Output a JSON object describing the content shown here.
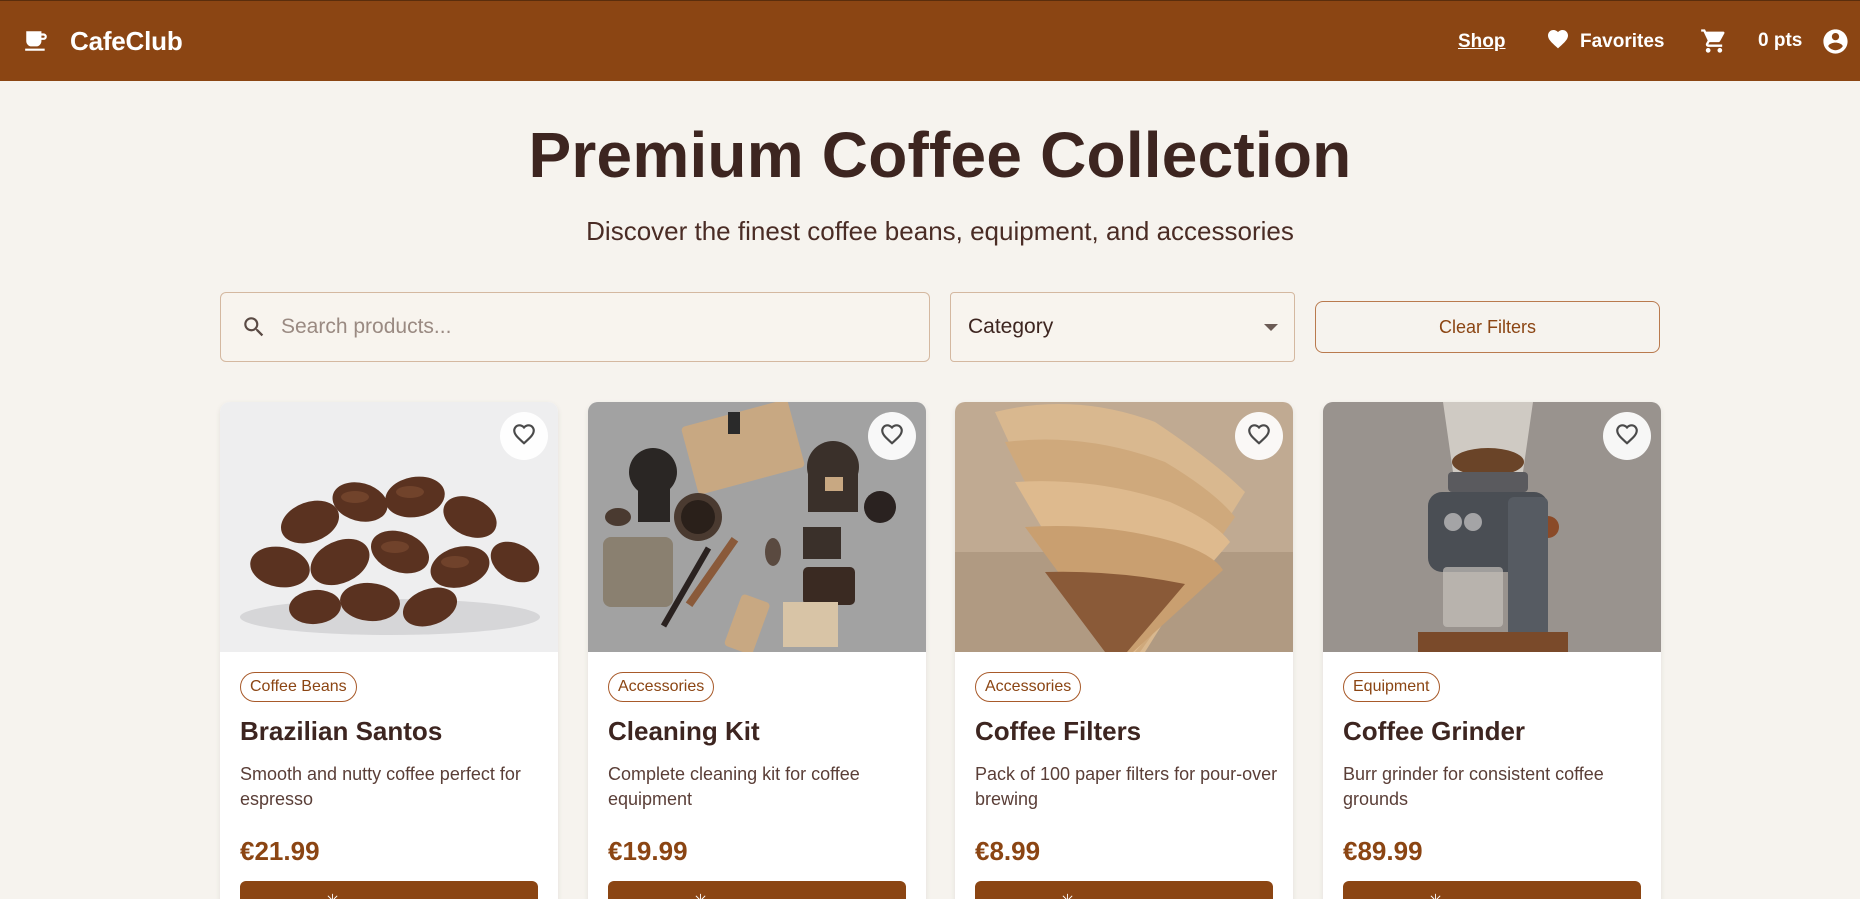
{
  "header": {
    "brand": "CafeClub",
    "nav_shop": "Shop",
    "nav_favorites": "Favorites",
    "points": "0 pts"
  },
  "hero": {
    "title": "Premium Coffee Collection",
    "subtitle": "Discover the finest coffee beans, equipment, and accessories"
  },
  "filters": {
    "search_placeholder": "Search products...",
    "category_label": "Category",
    "clear_label": "Clear Filters"
  },
  "products": [
    {
      "category": "Coffee Beans",
      "name": "Brazilian Santos",
      "description": "Smooth and nutty coffee perfect for espresso",
      "price": "€21.99",
      "image": "coffee-beans-photo"
    },
    {
      "category": "Accessories",
      "name": "Cleaning Kit",
      "description": "Complete cleaning kit for coffee equipment",
      "price": "€19.99",
      "image": "cleaning-kit-photo"
    },
    {
      "category": "Accessories",
      "name": "Coffee Filters",
      "description": "Pack of 100 paper filters for pour-over brewing",
      "price": "€8.99",
      "image": "coffee-filters-photo"
    },
    {
      "category": "Equipment",
      "name": "Coffee Grinder",
      "description": "Burr grinder for consistent coffee grounds",
      "price": "€89.99",
      "image": "coffee-grinder-photo"
    }
  ],
  "icons": {
    "brand": "coffee-cup-icon",
    "favorites": "heart-icon",
    "cart": "cart-icon",
    "account": "account-icon",
    "search": "search-icon",
    "favorite_toggle": "heart-outline-icon"
  },
  "colors": {
    "brand": "#8b4513",
    "background": "#f6f3ee",
    "text_dark": "#3d2520"
  }
}
